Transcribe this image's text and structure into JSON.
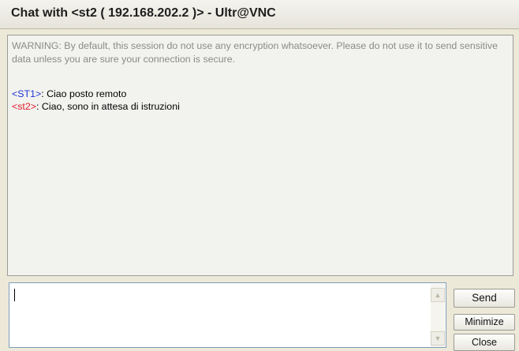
{
  "window": {
    "title": "Chat with <st2 ( 192.168.202.2 )> - Ultr@VNC"
  },
  "log": {
    "warning": "WARNING: By default, this session do not use any encryption whatsoever. Please do not use it to send sensitive data unless you are sure your connection is secure.",
    "messages": [
      {
        "nick": "<ST1>",
        "separator": ": ",
        "text": "Ciao posto remoto",
        "nick_color": "#1f35d6"
      },
      {
        "nick": "<st2>",
        "separator": ": ",
        "text": "Ciao, sono in attesa di istruzioni",
        "nick_color": "#e0202a"
      }
    ]
  },
  "input": {
    "value": "",
    "scroll_up_icon": "chevron-up-icon",
    "scroll_down_icon": "chevron-down-icon"
  },
  "buttons": {
    "send": "Send",
    "minimize": "Minimize",
    "close": "Close"
  },
  "colors": {
    "warning_text": "#8a8a8a",
    "local_nick": "#1f35d6",
    "remote_nick": "#e0202a"
  }
}
